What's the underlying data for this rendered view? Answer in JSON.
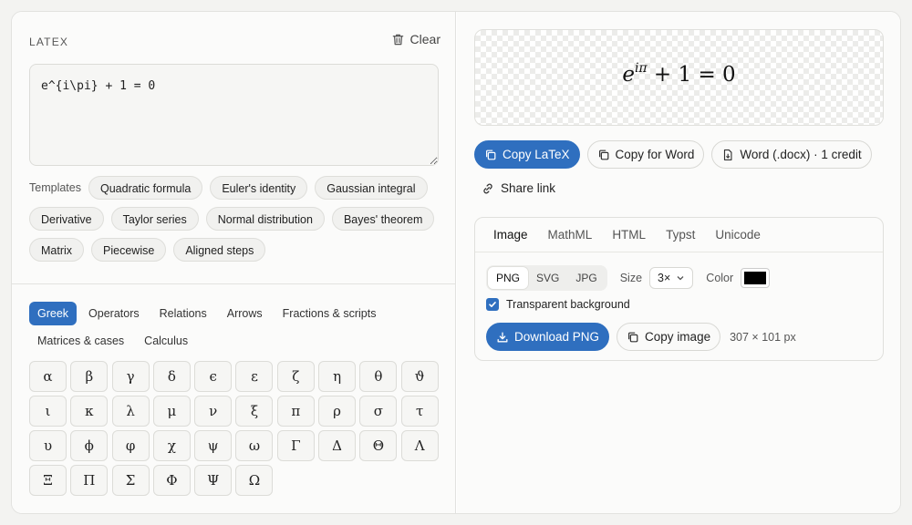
{
  "editor": {
    "label": "LATEX",
    "clear_label": "Clear",
    "value": "e^{i\\pi} + 1 = 0"
  },
  "templates": {
    "label": "Templates",
    "items": [
      "Quadratic formula",
      "Euler's identity",
      "Gaussian integral",
      "Derivative",
      "Taylor series",
      "Normal distribution",
      "Bayes' theorem",
      "Matrix",
      "Piecewise",
      "Aligned steps"
    ]
  },
  "symbols": {
    "tabs": [
      "Greek",
      "Operators",
      "Relations",
      "Arrows",
      "Fractions & scripts",
      "Matrices & cases",
      "Calculus"
    ],
    "active_tab": "Greek",
    "grid": [
      "α",
      "β",
      "γ",
      "δ",
      "ϵ",
      "ε",
      "ζ",
      "η",
      "θ",
      "ϑ",
      "ι",
      "κ",
      "λ",
      "μ",
      "ν",
      "ξ",
      "π",
      "ρ",
      "σ",
      "τ",
      "υ",
      "ϕ",
      "φ",
      "χ",
      "ψ",
      "ω",
      "Γ",
      "Δ",
      "Θ",
      "Λ",
      "Ξ",
      "Π",
      "Σ",
      "Φ",
      "Ψ",
      "Ω"
    ]
  },
  "preview": {
    "base": "e",
    "exponent": "iπ",
    "rest": " + 1 = 0"
  },
  "actions": {
    "copy_latex": "Copy LaTeX",
    "copy_word": "Copy for Word",
    "word_docx": "Word (.docx) · 1 credit",
    "share": "Share link"
  },
  "export": {
    "tabs": [
      "Image",
      "MathML",
      "HTML",
      "Typst",
      "Unicode"
    ],
    "active_tab": "Image",
    "formats": [
      "PNG",
      "SVG",
      "JPG"
    ],
    "active_format": "PNG",
    "size_label": "Size",
    "size_value": "3×",
    "color_label": "Color",
    "color_value": "#000000",
    "transparent_label": "Transparent background",
    "transparent_checked": true,
    "download_label": "Download PNG",
    "copy_image_label": "Copy image",
    "dimensions": "307 × 101 px"
  },
  "colors": {
    "accent": "#2f6fbf"
  }
}
